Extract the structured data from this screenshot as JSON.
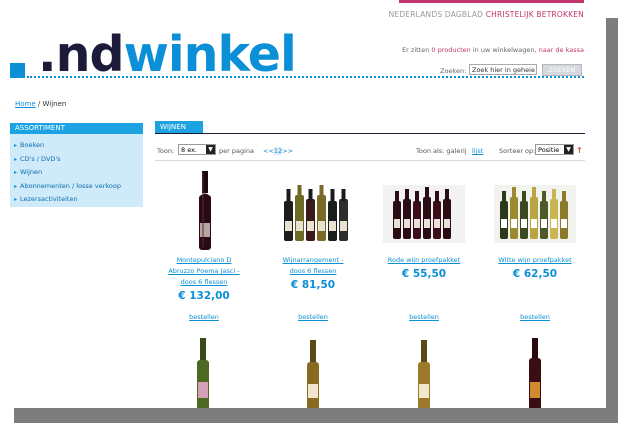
{
  "header": {
    "top_link_prefix": "NEDERLANDS DAGBLAD",
    "top_link_brand": "CHRISTELIJK BETROKKEN",
    "logo_nd": ".nd",
    "logo_winkel": "winkel",
    "cart_text_1": "Er zitten",
    "cart_count_text": "0 producten",
    "cart_text_2": "in uw winkelwagen,",
    "cart_checkout": "naar de kassa",
    "search_label": "Zoeken:",
    "search_value": "Zoek hier in geheie",
    "search_button": "ZOEKEN",
    "colors": {
      "accent": "#0b8fd6",
      "brand_pink": "#c0366e",
      "dark": "#1c1c3a"
    }
  },
  "breadcrumb": {
    "home": "Home",
    "separator": "/",
    "current": "Wijnen"
  },
  "sidebar": {
    "title": "ASSORTIMENT",
    "items": [
      "Boeken",
      "CD's / DVD's",
      "Wijnen",
      "Abonnementen / losse verkoop",
      "Lezersactiviteiten"
    ]
  },
  "section": {
    "title": "WIJNEN"
  },
  "toolbar": {
    "show_label": "Toon:",
    "show_value": "8 ex.",
    "per_page": "per pagina",
    "pager_prev": "<<",
    "pager_current": "12",
    "pager_next": ">>",
    "view_label": "Toon als: galerij",
    "view_list": "lijst",
    "sort_label": "Sorteer op:",
    "sort_value": "Positie"
  },
  "products": [
    {
      "name_line1": "Montepulciano D",
      "name_line2": "Abruzzo Poema Jasci -",
      "name_line3": "doos 6 flessen",
      "price": "€ 132,00",
      "order": "bestellen",
      "icon": "single-red-wine-bottle"
    },
    {
      "name_line1": "Wijnarrangement -",
      "name_line2": "doos 6 flessen",
      "name_line3": "",
      "price": "€ 81,50",
      "order": "bestellen",
      "icon": "six-wine-bottles"
    },
    {
      "name_line1": "Rode wijn proefpakket",
      "name_line2": "",
      "name_line3": "",
      "price": "€ 55,50",
      "order": "bestellen",
      "icon": "red-wine-bottles"
    },
    {
      "name_line1": "Witte wijn proefpakket",
      "name_line2": "",
      "name_line3": "",
      "price": "€ 62,50",
      "order": "bestellen",
      "icon": "white-wine-bottles"
    }
  ]
}
